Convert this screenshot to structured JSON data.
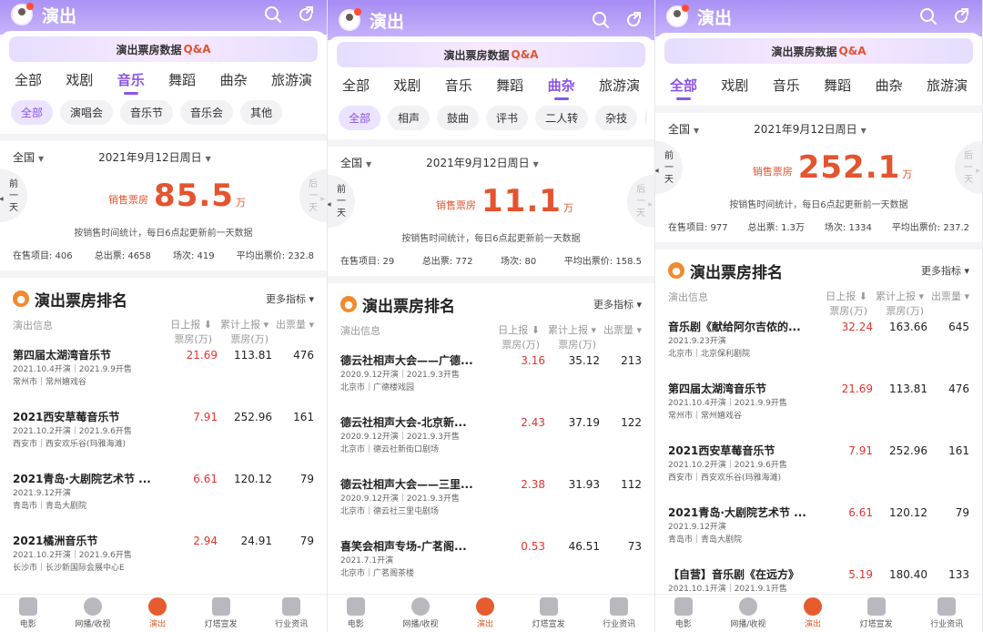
{
  "header": {
    "title": "演出"
  },
  "qa_banner": {
    "text": "演出票房数据",
    "qa": "Q&A"
  },
  "panels": [
    {
      "tabs": [
        "全部",
        "戏剧",
        "音乐",
        "舞蹈",
        "曲杂",
        "旅游演"
      ],
      "active_tab": 2,
      "chips": [
        "全部",
        "演唱会",
        "音乐节",
        "音乐会",
        "其他"
      ],
      "region": "全国",
      "date": "2021年9月12日周日",
      "prev": [
        "前",
        "一",
        "天"
      ],
      "next": [
        "后",
        "一",
        "天"
      ],
      "sales_label": "销售票房",
      "sales_value": "85.5",
      "sales_unit": "万",
      "note": "按销售时间统计，每日6点起更新前一天数据",
      "stats": [
        "在售项目: 406",
        "总出票: 4658",
        "场次: 419",
        "平均出票价: 232.8"
      ],
      "rank_title": "演出票房排名",
      "more": "更多指标",
      "col_info": "演出信息",
      "col_daily": [
        "日上报",
        "票房(万)"
      ],
      "col_total": [
        "累计上报",
        "票房(万)"
      ],
      "col_tickets": "出票量",
      "rows": [
        {
          "name": "第四届太湖湾音乐节",
          "l1": "2021.10.4开演｜2021.9.9开售",
          "l2": "常州市｜常州嬉戏谷",
          "daily": "21.69",
          "total": "113.81",
          "tickets": "476"
        },
        {
          "name": "2021西安草莓音乐节",
          "l1": "2021.10.2开演｜2021.9.6开售",
          "l2": "西安市｜西安欢乐谷(玛雅海滩)",
          "daily": "7.91",
          "total": "252.96",
          "tickets": "161"
        },
        {
          "name": "2021青岛·大剧院艺术节 ...",
          "l1": "2021.9.12开演",
          "l2": "青岛市｜青岛大剧院",
          "daily": "6.61",
          "total": "120.12",
          "tickets": "79"
        },
        {
          "name": "2021橘洲音乐节",
          "l1": "2021.10.2开演｜2021.9.6开售",
          "l2": "长沙市｜长沙新国际会展中心E",
          "daily": "2.94",
          "total": "24.91",
          "tickets": "79"
        }
      ],
      "nav": [
        "电影",
        "网播/收视",
        "演出",
        "灯塔宣发",
        "行业资讯"
      ]
    },
    {
      "tabs": [
        "全部",
        "戏剧",
        "音乐",
        "舞蹈",
        "曲杂",
        "旅游演"
      ],
      "active_tab": 4,
      "chips": [
        "全部",
        "相声",
        "鼓曲",
        "评书",
        "二人转",
        "杂技",
        "其"
      ],
      "region": "全国",
      "date": "2021年9月12日周日",
      "prev": [
        "前",
        "一",
        "天"
      ],
      "next": [
        "后",
        "一",
        "天"
      ],
      "sales_label": "销售票房",
      "sales_value": "11.1",
      "sales_unit": "万",
      "note": "按销售时间统计，每日6点起更新前一天数据",
      "stats": [
        "在售项目: 29",
        "总出票: 772",
        "场次: 80",
        "平均出票价: 158.5"
      ],
      "rank_title": "演出票房排名",
      "more": "更多指标",
      "col_info": "演出信息",
      "col_daily": [
        "日上报",
        "票房(万)"
      ],
      "col_total": [
        "累计上报",
        "票房(万)"
      ],
      "col_tickets": "出票量",
      "rows": [
        {
          "name": "德云社相声大会——广德...",
          "l1": "2020.9.12开演｜2021.9.3开售",
          "l2": "北京市｜广德楼戏园",
          "daily": "3.16",
          "total": "35.12",
          "tickets": "213"
        },
        {
          "name": "德云社相声大会-北京新...",
          "l1": "2020.9.12开演｜2021.9.3开售",
          "l2": "北京市｜德云社新街口剧场",
          "daily": "2.43",
          "total": "37.19",
          "tickets": "122"
        },
        {
          "name": "德云社相声大会——三里...",
          "l1": "2020.9.12开演｜2021.9.3开售",
          "l2": "北京市｜德云社三里屯剧场",
          "daily": "2.38",
          "total": "31.93",
          "tickets": "112"
        },
        {
          "name": "喜笑会相声专场-广茗阁...",
          "l1": "2021.7.1开演",
          "l2": "北京市｜广茗阁茶楼",
          "daily": "0.53",
          "total": "46.51",
          "tickets": "73"
        }
      ],
      "nav": [
        "电影",
        "网播/收视",
        "演出",
        "灯塔宣发",
        "行业资讯"
      ]
    },
    {
      "tabs": [
        "全部",
        "戏剧",
        "音乐",
        "舞蹈",
        "曲杂",
        "旅游演"
      ],
      "active_tab": 0,
      "chips": [],
      "region": "全国",
      "date": "2021年9月12日周日",
      "prev": [
        "前",
        "一",
        "天"
      ],
      "next": [
        "后",
        "一",
        "天"
      ],
      "sales_label": "销售票房",
      "sales_value": "252.1",
      "sales_unit": "万",
      "note": "按销售时间统计，每日6点起更新前一天数据",
      "stats": [
        "在售项目: 977",
        "总出票: 1.3万",
        "场次: 1334",
        "平均出票价: 237.2"
      ],
      "rank_title": "演出票房排名",
      "more": "更多指标",
      "col_info": "演出信息",
      "col_daily": [
        "日上报",
        "票房(万)"
      ],
      "col_total": [
        "累计上报",
        "票房(万)"
      ],
      "col_tickets": "出票量",
      "rows": [
        {
          "name": "音乐剧《献给阿尔吉侬的...",
          "l1": "2021.9.23开演",
          "l2": "北京市｜北京保利剧院",
          "daily": "32.24",
          "total": "163.66",
          "tickets": "645"
        },
        {
          "name": "第四届太湖湾音乐节",
          "l1": "2021.10.4开演｜2021.9.9开售",
          "l2": "常州市｜常州嬉戏谷",
          "daily": "21.69",
          "total": "113.81",
          "tickets": "476"
        },
        {
          "name": "2021西安草莓音乐节",
          "l1": "2021.10.2开演｜2021.9.6开售",
          "l2": "西安市｜西安欢乐谷(玛雅海滩)",
          "daily": "7.91",
          "total": "252.96",
          "tickets": "161"
        },
        {
          "name": "2021青岛·大剧院艺术节 ...",
          "l1": "2021.9.12开演",
          "l2": "青岛市｜青岛大剧院",
          "daily": "6.61",
          "total": "120.12",
          "tickets": "79"
        },
        {
          "name": "【自营】音乐剧《在远方》",
          "l1": "2021.10.1开演｜2021.9.1开售",
          "l2": "",
          "daily": "5.19",
          "total": "180.40",
          "tickets": "133"
        }
      ],
      "nav": [
        "电影",
        "网播/收视",
        "演出",
        "灯塔宣发",
        "行业资讯"
      ]
    }
  ]
}
